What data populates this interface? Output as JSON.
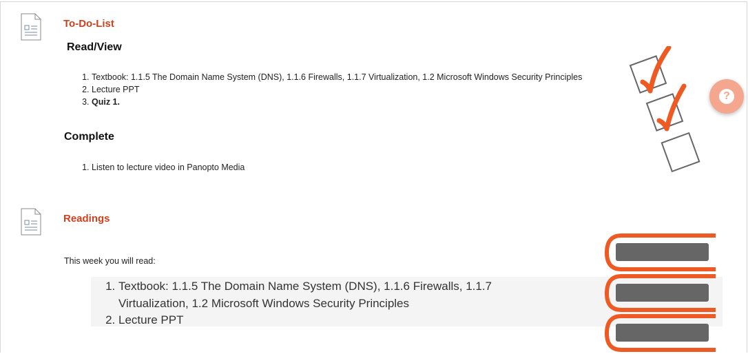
{
  "todo": {
    "title": "To-Do-List",
    "read_heading": "Read/View",
    "read_items": [
      "Textbook: 1.1.5 The Domain Name System (DNS), 1.1.6 Firewalls, 1.1.7 Virtualization,  1.2 Microsoft Windows Security Principles",
      "Lecture PPT",
      "Quiz 1."
    ],
    "complete_heading": "Complete",
    "complete_items": [
      "Listen to lecture video in Panopto Media"
    ]
  },
  "readings": {
    "title": "Readings",
    "intro": "This week you will read:",
    "items": [
      "Textbook: 1.1.5 The Domain Name System (DNS), 1.1.6 Firewalls, 1.1.7 Virtualization,  1.2 Microsoft Windows Security Principles",
      "Lecture PPT"
    ]
  },
  "help": {
    "icon": "question-icon",
    "glyph": "?"
  },
  "colors": {
    "accent": "#d0401b",
    "check": "#ee5a24",
    "box_gray": "#666666",
    "help_bg": "#f4a68f"
  }
}
